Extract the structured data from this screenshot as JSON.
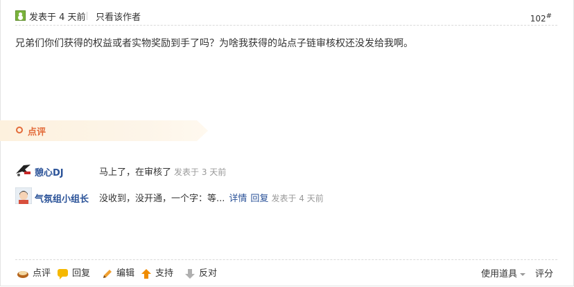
{
  "post": {
    "posted_label": "发表于 4 天前",
    "author_only_label": "只看该作者",
    "floor": "102",
    "floor_mark": "#",
    "content": "兄弟们你们获得的权益或者实物奖励到手了吗？为啥我获得的站点子链审核权还没发给我啊。"
  },
  "comments_section": {
    "title": "点评",
    "items": [
      {
        "user": "憩心DJ",
        "text": "马上了，在审核了",
        "time": "发表于 3 天前",
        "detail_label": "",
        "reply_label": ""
      },
      {
        "user": "气氛组小组长",
        "text": "没收到，没开通，一个字：等...",
        "time": "发表于 4 天前",
        "detail_label": "详情",
        "reply_label": "回复"
      }
    ]
  },
  "footer": {
    "comment_label": "点评",
    "reply_label": "回复",
    "edit_label": "编辑",
    "support_label": "支持",
    "oppose_label": "反对",
    "tools_label": "使用道具",
    "rate_label": "评分"
  },
  "colors": {
    "link": "#2a5298",
    "accent": "#e36b3a",
    "banner": "#fdf1de"
  },
  "icons": [
    "online-status-icon",
    "comment-icon",
    "reply-icon",
    "edit-icon",
    "support-icon",
    "oppose-icon",
    "dropdown-caret-icon"
  ]
}
